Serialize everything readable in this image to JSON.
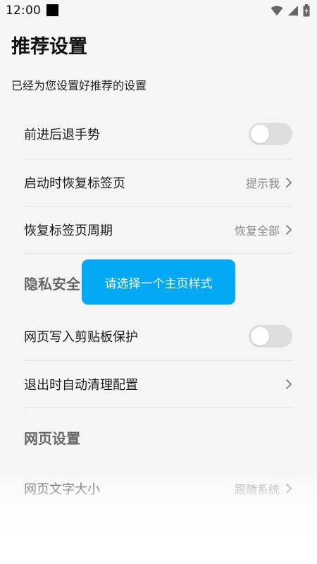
{
  "status_bar": {
    "time": "12:00"
  },
  "header": {
    "title": "推荐设置",
    "subtitle": "已经为您设置好推荐的设置"
  },
  "settings": {
    "gesture": {
      "label": "前进后退手势",
      "toggle_on": false
    },
    "restore_on_start": {
      "label": "启动时恢复标签页",
      "value": "提示我"
    },
    "restore_period": {
      "label": "恢复标签页周期",
      "value": "恢复全部"
    },
    "privacy_header": "隐私安全",
    "clipboard": {
      "label": "网页写入剪贴板保护",
      "toggle_on": false
    },
    "auto_clean": {
      "label": "退出时自动清理配置"
    },
    "web_header": "网页设置",
    "font_size": {
      "label": "网页文字大小",
      "value": "跟随系统"
    }
  },
  "toast": {
    "text": "请选择一个主页样式"
  },
  "colors": {
    "toast_bg": "#03a9f4",
    "toggle_off": "#dedede",
    "background": "#f5f5f5"
  },
  "icons": [
    "signal-icon",
    "wifi-icon",
    "battery-icon",
    "chevron-right-icon"
  ]
}
